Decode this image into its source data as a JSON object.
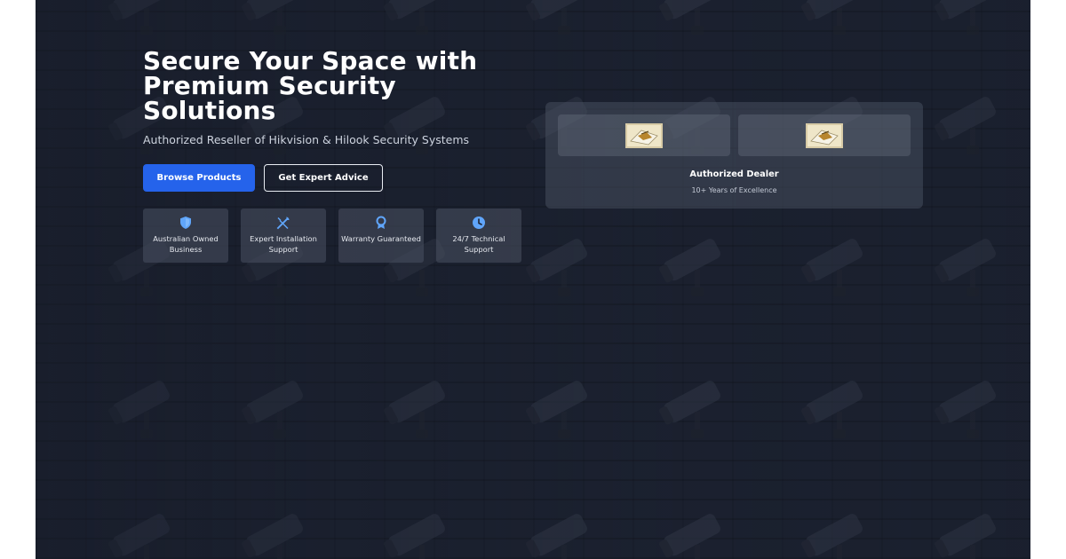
{
  "hero": {
    "title": "Secure Your Space with Premium Security Solutions",
    "subtitle": "Authorized Reseller of Hikvision & Hilook Security Systems",
    "buttons": {
      "primary_label": "Browse Products",
      "secondary_label": "Get Expert Advice"
    },
    "features": [
      {
        "icon": "shield-icon",
        "label": "Australian Owned Business"
      },
      {
        "icon": "tools-icon",
        "label": "Expert Installation Support"
      },
      {
        "icon": "award-icon",
        "label": "Warranty Guaranteed"
      },
      {
        "icon": "clock-icon",
        "label": "24/7 Technical Support"
      }
    ]
  },
  "dealer_card": {
    "title": "Authorized Dealer",
    "subtitle": "10+ Years of Excellence"
  },
  "colors": {
    "background": "#1d2332",
    "primary_button": "#2563eb",
    "icon_accent": "#60a5fa",
    "text": "#ffffff"
  }
}
